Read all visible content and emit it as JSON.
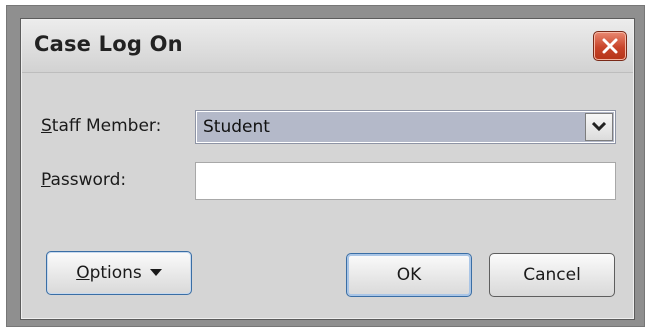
{
  "window": {
    "title": "Case Log On"
  },
  "form": {
    "staff_label_accel": "S",
    "staff_label_rest": "taff Member:",
    "staff_value": "Student",
    "password_label_accel": "P",
    "password_label_rest": "assword:",
    "password_value": ""
  },
  "buttons": {
    "options_accel": "O",
    "options_rest": "ptions",
    "ok_label": "OK",
    "cancel_label": "Cancel"
  },
  "icons": {
    "close": "close-x-icon",
    "dropdown": "chevron-down-icon",
    "options_caret": "caret-down-icon"
  },
  "colors": {
    "close_button": "#c8442a",
    "combo_background": "#b4b9c9",
    "dialog_background": "#d5d5d5"
  }
}
